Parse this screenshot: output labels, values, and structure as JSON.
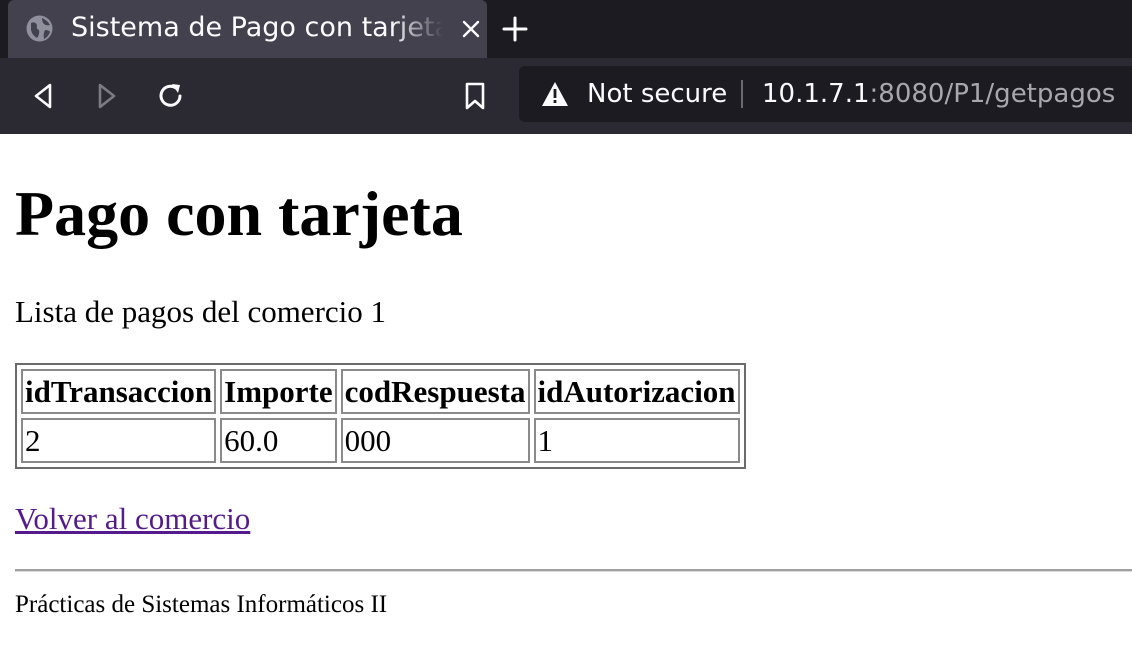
{
  "browser": {
    "tab": {
      "title": "Sistema de Pago con tarjeta",
      "icon": "globe-icon",
      "close_icon": "close-icon"
    },
    "new_tab_icon": "plus-icon",
    "nav": {
      "back_icon": "back-icon",
      "forward_icon": "forward-icon",
      "reload_icon": "reload-icon",
      "bookmark_icon": "bookmark-icon"
    },
    "urlbar": {
      "security_icon": "warning-icon",
      "security_label": "Not secure",
      "url_host": "10.1.7.1",
      "url_rest": ":8080/P1/getpagos"
    },
    "colors": {
      "tabstrip_bg": "#1c1b22",
      "tab_bg": "#42414d",
      "navbar_bg": "#2b2a33",
      "urlbar_bg": "#1c1b22",
      "chrome_text": "#fbfbfe"
    }
  },
  "page": {
    "heading": "Pago con tarjeta",
    "subtitle": "Lista de pagos del comercio 1",
    "table": {
      "headers": [
        "idTransaccion",
        "Importe",
        "codRespuesta",
        "idAutorizacion"
      ],
      "rows": [
        [
          "2",
          "60.0",
          "000",
          "1"
        ]
      ]
    },
    "back_link": "Volver al comercio",
    "footer": "Prácticas de Sistemas Informáticos II",
    "colors": {
      "visited_link": "#551a8b",
      "text": "#000000"
    }
  }
}
